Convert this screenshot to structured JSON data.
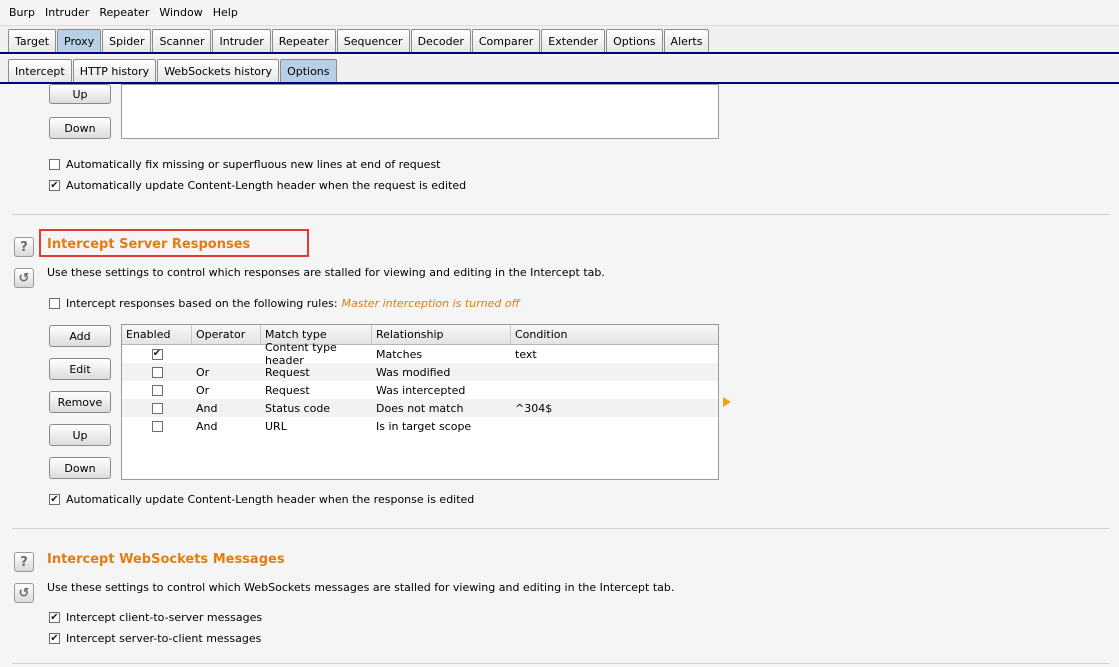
{
  "menu": [
    "Burp",
    "Intruder",
    "Repeater",
    "Window",
    "Help"
  ],
  "main_tabs": [
    "Target",
    "Proxy",
    "Spider",
    "Scanner",
    "Intruder",
    "Repeater",
    "Sequencer",
    "Decoder",
    "Comparer",
    "Extender",
    "Options",
    "Alerts"
  ],
  "main_active": "Proxy",
  "sub_tabs": [
    "Intercept",
    "HTTP history",
    "WebSockets history",
    "Options"
  ],
  "sub_active": "Options",
  "top_section": {
    "up_label": "Up",
    "down_label": "Down",
    "fix_newlines": "Automatically fix missing or superfluous new lines at end of request",
    "fix_newlines_checked": false,
    "update_length_request": "Automatically update Content-Length header when the request is edited",
    "update_length_request_checked": true
  },
  "responses_section": {
    "title": "Intercept Server Responses",
    "description": "Use these settings to control which responses are stalled for viewing and editing in the Intercept tab.",
    "rules_checkbox": "Intercept responses based on the following rules:",
    "rules_checked": false,
    "status": "Master interception is turned off",
    "buttons": {
      "add": "Add",
      "edit": "Edit",
      "remove": "Remove",
      "up": "Up",
      "down": "Down"
    },
    "columns": [
      "Enabled",
      "Operator",
      "Match type",
      "Relationship",
      "Condition"
    ],
    "rows": [
      {
        "enabled": true,
        "operator": "",
        "match_type": "Content type header",
        "relationship": "Matches",
        "condition": "text"
      },
      {
        "enabled": false,
        "operator": "Or",
        "match_type": "Request",
        "relationship": "Was modified",
        "condition": ""
      },
      {
        "enabled": false,
        "operator": "Or",
        "match_type": "Request",
        "relationship": "Was intercepted",
        "condition": ""
      },
      {
        "enabled": false,
        "operator": "And",
        "match_type": "Status code",
        "relationship": "Does not match",
        "condition": "^304$"
      },
      {
        "enabled": false,
        "operator": "And",
        "match_type": "URL",
        "relationship": "Is in target scope",
        "condition": ""
      }
    ],
    "update_length_response": "Automatically update Content-Length header when the response is edited",
    "update_length_response_checked": true
  },
  "websockets_section": {
    "title": "Intercept WebSockets Messages",
    "description": "Use these settings to control which WebSockets messages are stalled for viewing and editing in the Intercept tab.",
    "client_to_server": "Intercept client-to-server messages",
    "client_to_server_checked": true,
    "server_to_client": "Intercept server-to-client messages",
    "server_to_client_checked": true
  },
  "colors": {
    "section_title": "#e27d0e",
    "highlight": "#e53935",
    "active_tab": "#b8cfe5"
  }
}
